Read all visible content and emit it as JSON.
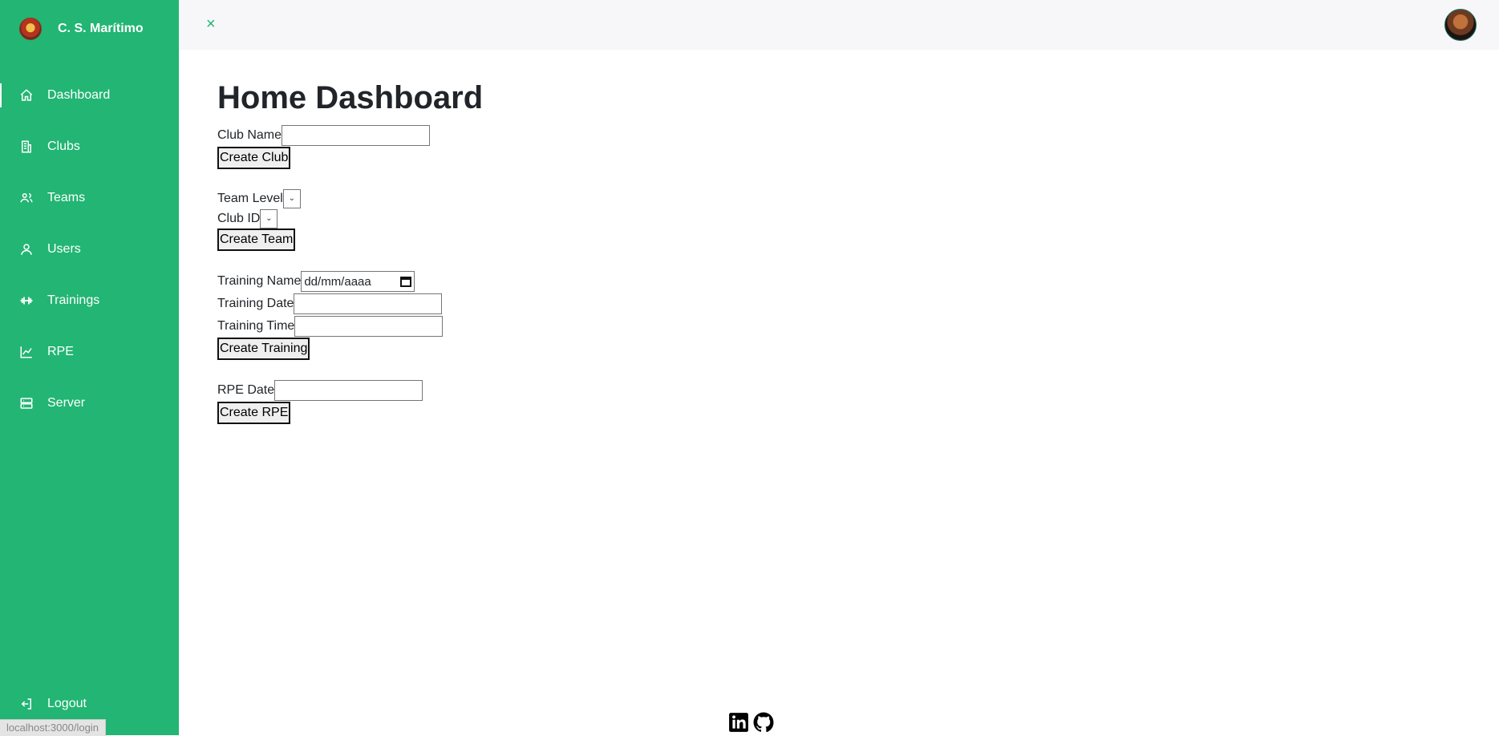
{
  "brand": {
    "name": "C. S. Marítimo"
  },
  "sidebar": {
    "items": [
      {
        "label": "Dashboard",
        "icon": "home-icon"
      },
      {
        "label": "Clubs",
        "icon": "building-icon"
      },
      {
        "label": "Teams",
        "icon": "users-icon"
      },
      {
        "label": "Users",
        "icon": "user-icon"
      },
      {
        "label": "Trainings",
        "icon": "dumbbell-icon"
      },
      {
        "label": "RPE",
        "icon": "chart-line-icon"
      },
      {
        "label": "Server",
        "icon": "server-icon"
      }
    ],
    "logout_label": "Logout"
  },
  "status_bar": {
    "url": "localhost:3000/login"
  },
  "topbar": {
    "close_glyph": "×"
  },
  "main": {
    "title": "Home Dashboard",
    "club_form": {
      "name_label": "Club Name",
      "name_value": "",
      "submit": "Create Club"
    },
    "team_form": {
      "level_label": "Team Level",
      "club_id_label": "Club ID",
      "submit": "Create Team"
    },
    "training_form": {
      "name_label": "Training Name",
      "name_placeholder": "dd/mm/aaaa",
      "date_label": "Training Date",
      "time_label": "Training Time",
      "submit": "Create Training"
    },
    "rpe_form": {
      "date_label": "RPE Date",
      "submit": "Create RPE"
    }
  },
  "colors": {
    "sidebar_bg": "#22b573",
    "accent": "#22b573",
    "topbar_bg": "#f7f7fa"
  }
}
